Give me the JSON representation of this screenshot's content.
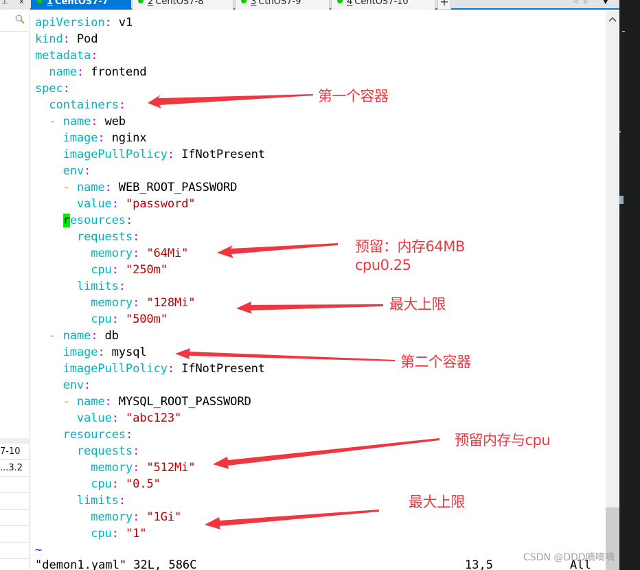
{
  "left_panel": {
    "pin_glyph": "⊥",
    "close_glyph": "x",
    "search_icon": "search-icon",
    "rows": [
      "7-10",
      "3.2...",
      "",
      "",
      "",
      "",
      ""
    ]
  },
  "tabs": [
    {
      "num": "1",
      "label": "CentOS7-7",
      "active": true,
      "status_color": "#16c60c"
    },
    {
      "num": "2",
      "label": "CentOS7-8",
      "active": false,
      "status_color": "#16c60c"
    },
    {
      "num": "3",
      "label": "CthOS7-9",
      "active": false,
      "status_color": "#16c60c"
    },
    {
      "num": "4",
      "label": "CentOS7-10",
      "active": false,
      "status_color": "#16c60c"
    }
  ],
  "tab_add_label": "+",
  "editor": {
    "lines": [
      [
        {
          "c": "k",
          "t": "apiVersion"
        },
        {
          "c": "c",
          "t": ":"
        },
        {
          "t": " v1"
        }
      ],
      [
        {
          "c": "k",
          "t": "kind"
        },
        {
          "c": "c",
          "t": ":"
        },
        {
          "t": " Pod"
        }
      ],
      [
        {
          "c": "k",
          "t": "metadata"
        },
        {
          "c": "c",
          "t": ":"
        }
      ],
      [
        {
          "t": "  "
        },
        {
          "c": "k",
          "t": "name"
        },
        {
          "c": "c",
          "t": ":"
        },
        {
          "t": " frontend"
        }
      ],
      [
        {
          "c": "k",
          "t": "spec"
        },
        {
          "c": "c",
          "t": ":"
        }
      ],
      [
        {
          "t": "  "
        },
        {
          "c": "k",
          "t": "containers"
        },
        {
          "c": "c",
          "t": ":"
        }
      ],
      [
        {
          "t": "  "
        },
        {
          "c": "d",
          "t": "-"
        },
        {
          "t": " "
        },
        {
          "c": "k",
          "t": "name"
        },
        {
          "c": "c",
          "t": ":"
        },
        {
          "t": " web"
        }
      ],
      [
        {
          "t": "    "
        },
        {
          "c": "k",
          "t": "image"
        },
        {
          "c": "c",
          "t": ":"
        },
        {
          "t": " nginx"
        }
      ],
      [
        {
          "t": "    "
        },
        {
          "c": "k",
          "t": "imagePullPolicy"
        },
        {
          "c": "c",
          "t": ":"
        },
        {
          "t": " IfNotPresent"
        }
      ],
      [
        {
          "t": "    "
        },
        {
          "c": "k",
          "t": "env"
        },
        {
          "c": "c",
          "t": ":"
        }
      ],
      [
        {
          "t": "    "
        },
        {
          "c": "d",
          "t": "-"
        },
        {
          "t": " "
        },
        {
          "c": "k",
          "t": "name"
        },
        {
          "c": "c",
          "t": ":"
        },
        {
          "t": " WEB_ROOT_PASSWORD"
        }
      ],
      [
        {
          "t": "      "
        },
        {
          "c": "k",
          "t": "value"
        },
        {
          "c": "c",
          "t": ":"
        },
        {
          "t": " "
        },
        {
          "c": "s",
          "t": "\"password\""
        }
      ],
      [
        {
          "t": "    "
        },
        {
          "c": "cursor",
          "t": "r"
        },
        {
          "c": "k",
          "t": "esources"
        },
        {
          "c": "c",
          "t": ":"
        }
      ],
      [
        {
          "t": "      "
        },
        {
          "c": "k",
          "t": "requests"
        },
        {
          "c": "c",
          "t": ":"
        }
      ],
      [
        {
          "t": "        "
        },
        {
          "c": "k",
          "t": "memory"
        },
        {
          "c": "c",
          "t": ":"
        },
        {
          "t": " "
        },
        {
          "c": "s",
          "t": "\"64Mi\""
        }
      ],
      [
        {
          "t": "        "
        },
        {
          "c": "k",
          "t": "cpu"
        },
        {
          "c": "c",
          "t": ":"
        },
        {
          "t": " "
        },
        {
          "c": "s",
          "t": "\"250m\""
        }
      ],
      [
        {
          "t": "      "
        },
        {
          "c": "k",
          "t": "limits"
        },
        {
          "c": "c",
          "t": ":"
        }
      ],
      [
        {
          "t": "        "
        },
        {
          "c": "k",
          "t": "memory"
        },
        {
          "c": "c",
          "t": ":"
        },
        {
          "t": " "
        },
        {
          "c": "s",
          "t": "\"128Mi\""
        }
      ],
      [
        {
          "t": "        "
        },
        {
          "c": "k",
          "t": "cpu"
        },
        {
          "c": "c",
          "t": ":"
        },
        {
          "t": " "
        },
        {
          "c": "s",
          "t": "\"500m\""
        }
      ],
      [
        {
          "t": "  "
        },
        {
          "c": "d",
          "t": "-"
        },
        {
          "t": " "
        },
        {
          "c": "k",
          "t": "name"
        },
        {
          "c": "c",
          "t": ":"
        },
        {
          "t": " db"
        }
      ],
      [
        {
          "t": "    "
        },
        {
          "c": "k",
          "t": "image"
        },
        {
          "c": "c",
          "t": ":"
        },
        {
          "t": " mysql"
        }
      ],
      [
        {
          "t": "    "
        },
        {
          "c": "k",
          "t": "imagePullPolicy"
        },
        {
          "c": "c",
          "t": ":"
        },
        {
          "t": " IfNotPresent"
        }
      ],
      [
        {
          "t": "    "
        },
        {
          "c": "k",
          "t": "env"
        },
        {
          "c": "c",
          "t": ":"
        }
      ],
      [
        {
          "t": "    "
        },
        {
          "c": "d",
          "t": "-"
        },
        {
          "t": " "
        },
        {
          "c": "k",
          "t": "name"
        },
        {
          "c": "c",
          "t": ":"
        },
        {
          "t": " MYSQL_ROOT_PASSWORD"
        }
      ],
      [
        {
          "t": "      "
        },
        {
          "c": "k",
          "t": "value"
        },
        {
          "c": "c",
          "t": ":"
        },
        {
          "t": " "
        },
        {
          "c": "s",
          "t": "\"abc123\""
        }
      ],
      [
        {
          "t": "    "
        },
        {
          "c": "k",
          "t": "resources"
        },
        {
          "c": "c",
          "t": ":"
        }
      ],
      [
        {
          "t": "      "
        },
        {
          "c": "k",
          "t": "requests"
        },
        {
          "c": "c",
          "t": ":"
        }
      ],
      [
        {
          "t": "        "
        },
        {
          "c": "k",
          "t": "memory"
        },
        {
          "c": "c",
          "t": ":"
        },
        {
          "t": " "
        },
        {
          "c": "s",
          "t": "\"512Mi\""
        }
      ],
      [
        {
          "t": "        "
        },
        {
          "c": "k",
          "t": "cpu"
        },
        {
          "c": "c",
          "t": ":"
        },
        {
          "t": " "
        },
        {
          "c": "s",
          "t": "\"0.5\""
        }
      ],
      [
        {
          "t": "      "
        },
        {
          "c": "k",
          "t": "limits"
        },
        {
          "c": "c",
          "t": ":"
        }
      ],
      [
        {
          "t": "        "
        },
        {
          "c": "k",
          "t": "memory"
        },
        {
          "c": "c",
          "t": ":"
        },
        {
          "t": " "
        },
        {
          "c": "s",
          "t": "\"1Gi\""
        }
      ],
      [
        {
          "t": "        "
        },
        {
          "c": "k",
          "t": "cpu"
        },
        {
          "c": "c",
          "t": ":"
        },
        {
          "t": " "
        },
        {
          "c": "s",
          "t": "\"1\""
        }
      ],
      [
        {
          "c": "t",
          "t": "~"
        }
      ]
    ],
    "status_file": "\"demon1.yaml\" 32L, 586C",
    "status_position": "13,5",
    "status_scroll": "All"
  },
  "annotations": [
    {
      "text": "第一个容器",
      "name": "first-container"
    },
    {
      "text": "预留：内存64MB",
      "name": "reserve-memory"
    },
    {
      "text": "cpu0.25",
      "name": "reserve-cpu"
    },
    {
      "text": "最大上限",
      "name": "max-limit-1"
    },
    {
      "text": "第二个容器",
      "name": "second-container"
    },
    {
      "text": "预留内存与cpu",
      "name": "reserve-memory-cpu"
    },
    {
      "text": "最大上限",
      "name": "max-limit-2"
    }
  ],
  "annotation_color": "#f2363f",
  "watermark": "CSDN @DDD嘀嘀嘀"
}
